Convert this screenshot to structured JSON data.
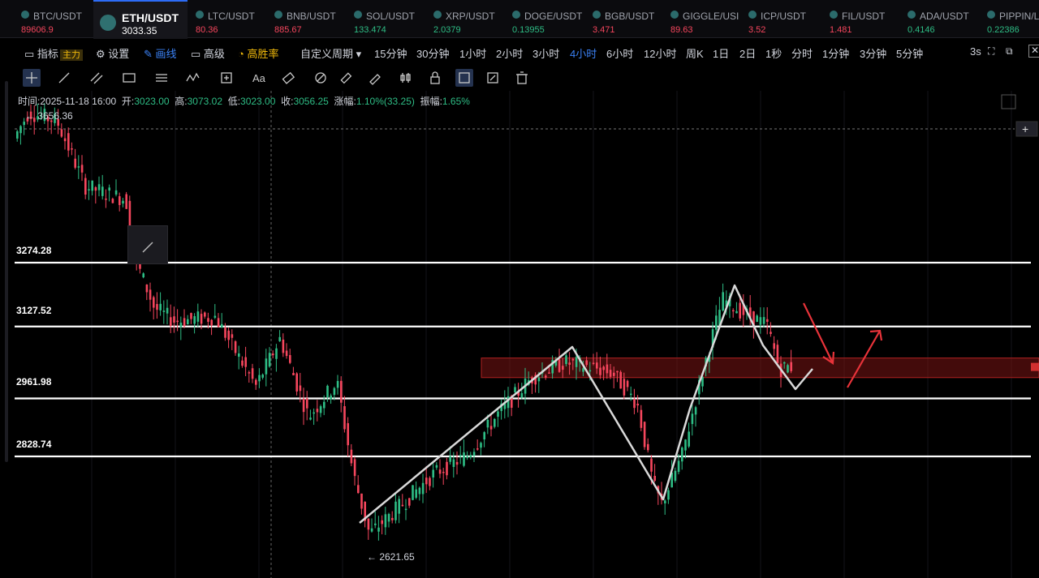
{
  "tickers": [
    {
      "symbol": "BTC/USDT",
      "price": "89606.9",
      "dir": "dn"
    },
    {
      "symbol": "ETH/USDT",
      "price": "3033.35",
      "dir": "active"
    },
    {
      "symbol": "LTC/USDT",
      "price": "80.36",
      "dir": "dn"
    },
    {
      "symbol": "BNB/USDT",
      "price": "885.67",
      "dir": "dn"
    },
    {
      "symbol": "SOL/USDT",
      "price": "133.474",
      "dir": "up"
    },
    {
      "symbol": "XRP/USDT",
      "price": "2.0379",
      "dir": "up"
    },
    {
      "symbol": "DOGE/USDT",
      "price": "0.13955",
      "dir": "up"
    },
    {
      "symbol": "BGB/USDT",
      "price": "3.471",
      "dir": "dn"
    },
    {
      "symbol": "GIGGLE/USI",
      "price": "89.63",
      "dir": "dn"
    },
    {
      "symbol": "ICP/USDT",
      "price": "3.52",
      "dir": "dn"
    },
    {
      "symbol": "FIL/USDT",
      "price": "1.481",
      "dir": "dn"
    },
    {
      "symbol": "ADA/USDT",
      "price": "0.4146",
      "dir": "up"
    },
    {
      "symbol": "PIPPIN/L",
      "price": "0.22386",
      "dir": "up"
    }
  ],
  "toolbar": {
    "indicator": "指标",
    "indicator_tag": "主力",
    "settings": "设置",
    "draw": "画线",
    "advanced": "高级",
    "win_rate": "高胜率",
    "custom_period": "自定义周期 ▾",
    "periods": [
      "15分钟",
      "30分钟",
      "1小时",
      "2小时",
      "3小时",
      "4小时",
      "6小时",
      "12小时",
      "周K",
      "1日",
      "2日",
      "1秒",
      "分时",
      "1分钟",
      "3分钟",
      "5分钟"
    ],
    "active_period": "4小时",
    "refresh": "3s"
  },
  "drawing_tools": [
    "crosshair-tool",
    "trend-line-tool",
    "parallel-channel-tool",
    "rectangle-tool",
    "fib-tool",
    "wave-tool",
    "measure-tool",
    "text-tool",
    "eraser-tool",
    "highlighter-tool",
    "ruler-tool",
    "brush-tool",
    "candles-tool",
    "lock-tool",
    "magnet-tool",
    "edit-tool",
    "delete-tool"
  ],
  "ohlc": {
    "time_label": "时间:",
    "time": "2025-11-18 16:00",
    "open_label": "开:",
    "open": "3023.00",
    "high_label": "高:",
    "high": "3073.02",
    "low_label": "低:",
    "low": "3023.00",
    "close_label": "收:",
    "close": "3056.25",
    "change_label": "涨幅:",
    "change": "1.10%(33.25)",
    "amp_label": "振幅:",
    "amp": "1.65%"
  },
  "chart_data": {
    "type": "candlestick",
    "ylim": [
      2580,
      3700
    ],
    "high_mark": "← 3656.36",
    "low_mark": "← 2621.65",
    "levels": [
      3274.28,
      3127.52,
      2961.98,
      2828.74
    ],
    "level_labels": [
      "3274.28",
      "3127.52",
      "2961.98",
      "2828.74"
    ],
    "zone": [
      3010,
      3055
    ],
    "colors": {
      "up": "#2ebd85",
      "down": "#f6465d",
      "level": "#ffffff",
      "zone": "#7a1414",
      "arrow": "#e8333a",
      "path": "#d9d9d9"
    }
  }
}
